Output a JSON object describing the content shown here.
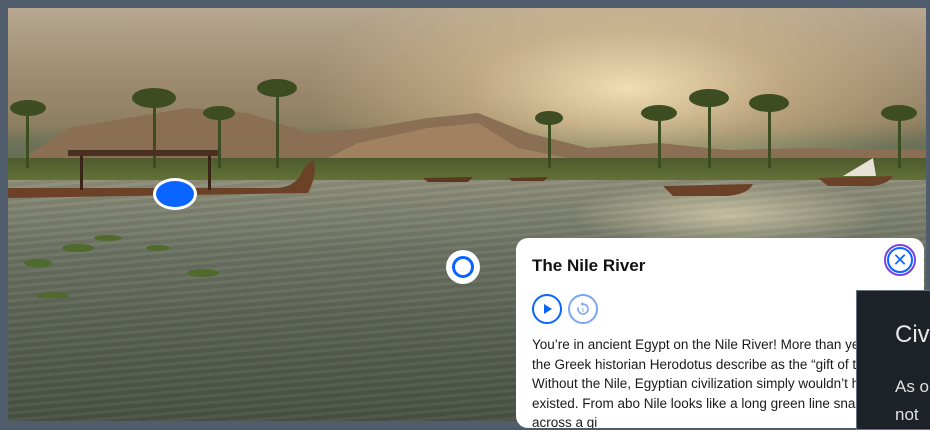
{
  "scene": {
    "alt": "Nile River 3D scene"
  },
  "hotspots": [
    {
      "label": "boat hotspot"
    },
    {
      "label": "river hotspot"
    }
  ],
  "info_card": {
    "title": "The Nile River",
    "close_icon": "close-icon",
    "play_icon": "play-icon",
    "replay_icon": "replay-icon",
    "text": "You’re in ancient Egypt on the Nile River! More than years ago, the Greek historian Herodotus describe as the “gift of the river.” Without the Nile, Egyptian civilization simply wouldn’t have existed. From abo Nile looks like a long green line snaking across a gi"
  },
  "side_panel": {
    "title": "Civ",
    "text_line1": "As o",
    "text_line2": "not"
  }
}
